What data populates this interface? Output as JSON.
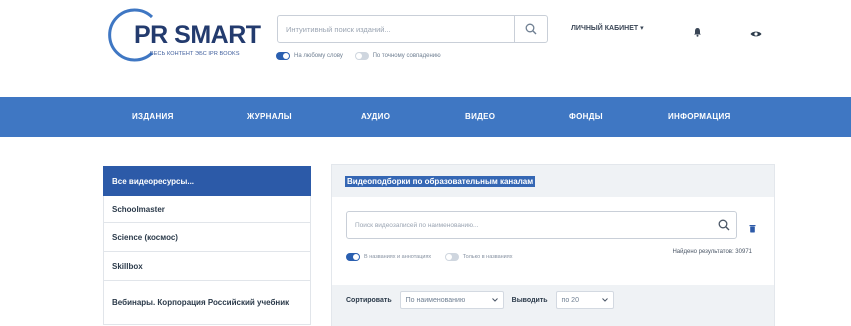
{
  "logo": {
    "title": "PR SMART",
    "subtitle": "ВЕСЬ КОНТЕНТ ЭБС IPR BOOKS"
  },
  "search": {
    "placeholder": "Интуитивный поиск изданий...",
    "options": [
      {
        "label": "На любому слову",
        "on": true
      },
      {
        "label": "По точному совпадению",
        "on": false
      }
    ]
  },
  "header": {
    "cabinet_label": "ЛИЧНЫЙ КАБИНЕТ",
    "cabinet_caret": "▾"
  },
  "nav": {
    "items": [
      "ИЗДАНИЯ",
      "ЖУРНАЛЫ",
      "АУДИО",
      "ВИДЕО",
      "ФОНДЫ",
      "ИНФОРМАЦИЯ"
    ]
  },
  "sidebar": {
    "items": [
      {
        "label": "Все видеоресурсы...",
        "active": true
      },
      {
        "label": "Schoolmaster",
        "active": false
      },
      {
        "label": "Science (космос)",
        "active": false
      },
      {
        "label": "Skillbox",
        "active": false
      },
      {
        "label": "Вебинары. Корпорация Российский учебник",
        "active": false
      }
    ]
  },
  "main": {
    "title": "Видеоподборки по образовательным каналам",
    "search_placeholder": "Поиск видеозаписей по наименованию...",
    "options": [
      {
        "label": "В названиях и аннотациях",
        "on": true
      },
      {
        "label": "Только в названиях",
        "on": false
      }
    ],
    "found_label": "Найдено результатов: 30971",
    "sort_label": "Сортировать",
    "sort_value": "По наименованию",
    "show_label": "Выводить",
    "show_value": "по 20"
  },
  "colors": {
    "nav_bg": "#3f77c3",
    "active_item": "#2c5aa8",
    "brand": "#233b6e",
    "title_highlight": "#3567b4"
  }
}
